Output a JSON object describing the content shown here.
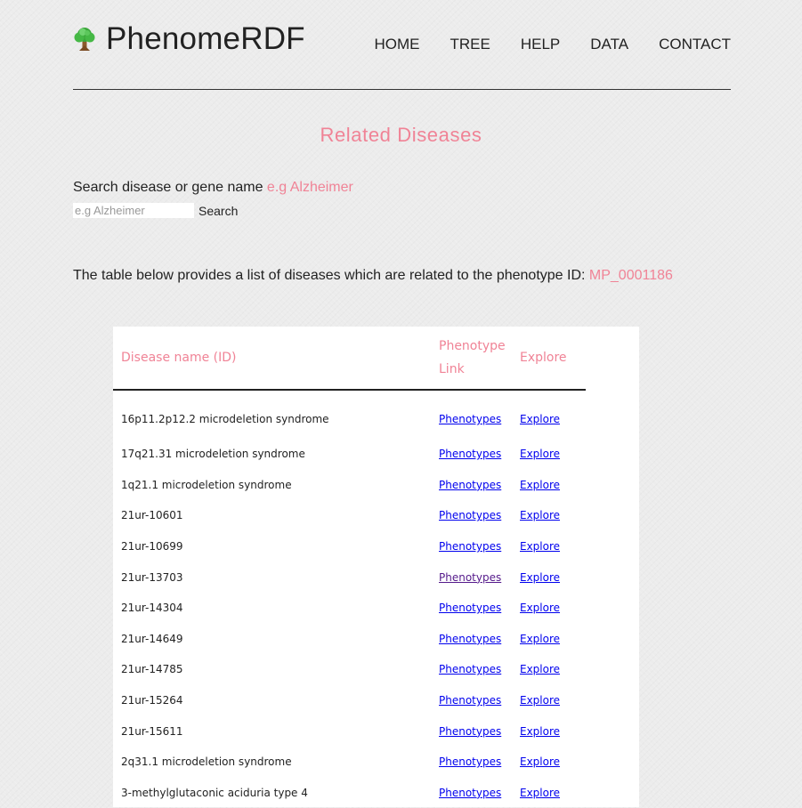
{
  "brand": {
    "title": "PhenomeRDF",
    "logo_icon": "tree-icon"
  },
  "nav": {
    "items": [
      {
        "label": "HOME"
      },
      {
        "label": "TREE"
      },
      {
        "label": "HELP"
      },
      {
        "label": "DATA"
      },
      {
        "label": "CONTACT"
      }
    ]
  },
  "page": {
    "title": "Related Diseases"
  },
  "search": {
    "label": "Search disease or gene name",
    "example": "e.g Alzheimer",
    "placeholder": "e.g Alzheimer",
    "value": "",
    "button_label": "Search"
  },
  "intro": {
    "text": "The table below provides a list of diseases which are related to the phenotype ID:",
    "phenotype_id": "MP_0001186"
  },
  "table": {
    "headers": {
      "name": "Disease name (ID)",
      "phenotype": "Phenotype Link",
      "explore": "Explore"
    },
    "rows": [
      {
        "name": "16p11.2p12.2 microdeletion syndrome",
        "phenotype": "Phenotypes",
        "explore": "Explore",
        "phenotype_visited": false
      },
      {
        "name": "17q21.31 microdeletion syndrome",
        "phenotype": "Phenotypes",
        "explore": "Explore",
        "phenotype_visited": false
      },
      {
        "name": "1q21.1 microdeletion syndrome",
        "phenotype": "Phenotypes",
        "explore": "Explore",
        "phenotype_visited": false
      },
      {
        "name": "21ur-10601",
        "phenotype": "Phenotypes",
        "explore": "Explore",
        "phenotype_visited": false
      },
      {
        "name": "21ur-10699",
        "phenotype": "Phenotypes",
        "explore": "Explore",
        "phenotype_visited": false
      },
      {
        "name": "21ur-13703",
        "phenotype": "Phenotypes",
        "explore": "Explore",
        "phenotype_visited": true
      },
      {
        "name": "21ur-14304",
        "phenotype": "Phenotypes",
        "explore": "Explore",
        "phenotype_visited": false
      },
      {
        "name": "21ur-14649",
        "phenotype": "Phenotypes",
        "explore": "Explore",
        "phenotype_visited": false
      },
      {
        "name": "21ur-14785",
        "phenotype": "Phenotypes",
        "explore": "Explore",
        "phenotype_visited": false
      },
      {
        "name": "21ur-15264",
        "phenotype": "Phenotypes",
        "explore": "Explore",
        "phenotype_visited": false
      },
      {
        "name": "21ur-15611",
        "phenotype": "Phenotypes",
        "explore": "Explore",
        "phenotype_visited": false
      },
      {
        "name": "2q31.1 microdeletion syndrome",
        "phenotype": "Phenotypes",
        "explore": "Explore",
        "phenotype_visited": false
      },
      {
        "name": "3-methylglutaconic aciduria type 4",
        "phenotype": "Phenotypes",
        "explore": "Explore",
        "phenotype_visited": false
      }
    ]
  },
  "colors": {
    "accent": "#f08396",
    "link": "#0000ee",
    "link_visited": "#551a8b",
    "text": "#222222"
  }
}
